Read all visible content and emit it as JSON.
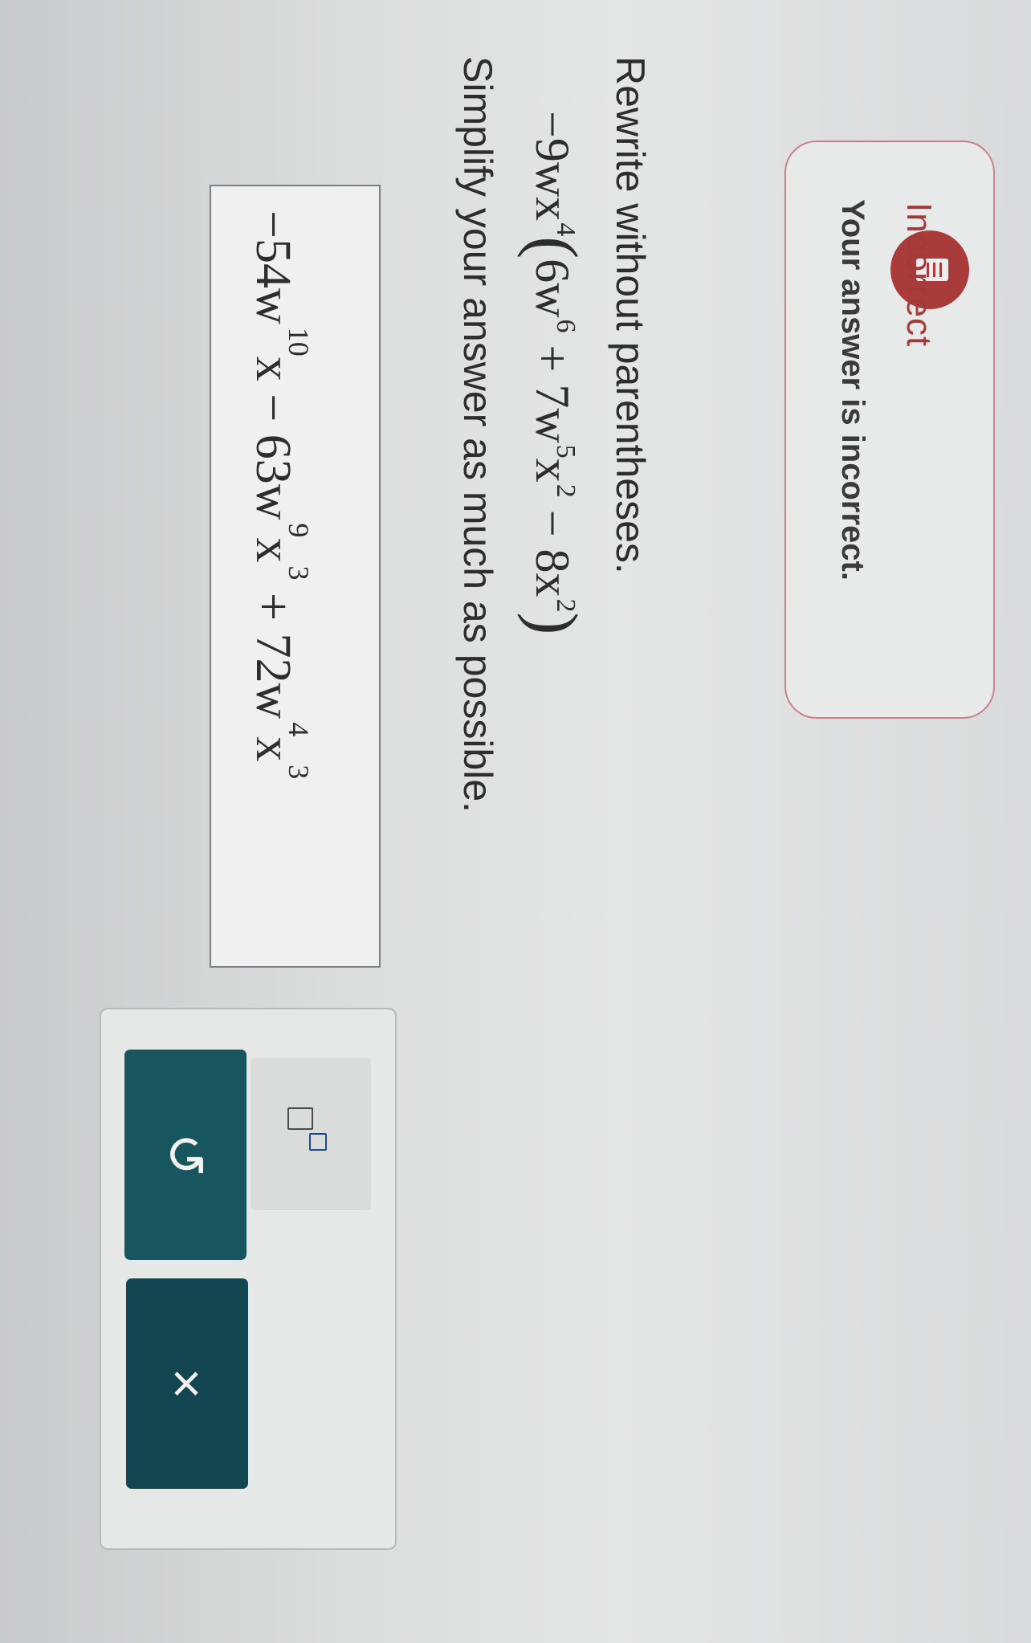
{
  "feedback": {
    "title": "Incorrect",
    "message": "Your answer is incorrect."
  },
  "question": {
    "prompt": "Rewrite without parentheses.",
    "expression": {
      "term_coeff": "−9",
      "term_vars": "wx",
      "term_exp": "4",
      "inner": [
        {
          "pre": "6w",
          "exp": "6"
        },
        {
          "pre": " + 7w",
          "exp": "5"
        },
        {
          "pre": "x",
          "exp": "2"
        },
        {
          "pre": " − 8x",
          "exp": "2"
        }
      ]
    },
    "instruction": "Simplify your answer as much as possible."
  },
  "answer": {
    "terms": [
      {
        "pre": "−54w",
        "exp": "10"
      },
      {
        "pre": "x − 63w",
        "exp": "9"
      },
      {
        "pre": "x",
        "exp": "3"
      },
      {
        "pre": " + 72w",
        "exp": "4"
      },
      {
        "pre": "x",
        "exp": "3"
      }
    ]
  },
  "toolbar": {
    "exponent_tool": "exponent-template-icon",
    "undo_icon": "↺",
    "clear_icon": "×"
  },
  "colors": {
    "incorrect": "#a93b3b",
    "button": "#17555f"
  }
}
